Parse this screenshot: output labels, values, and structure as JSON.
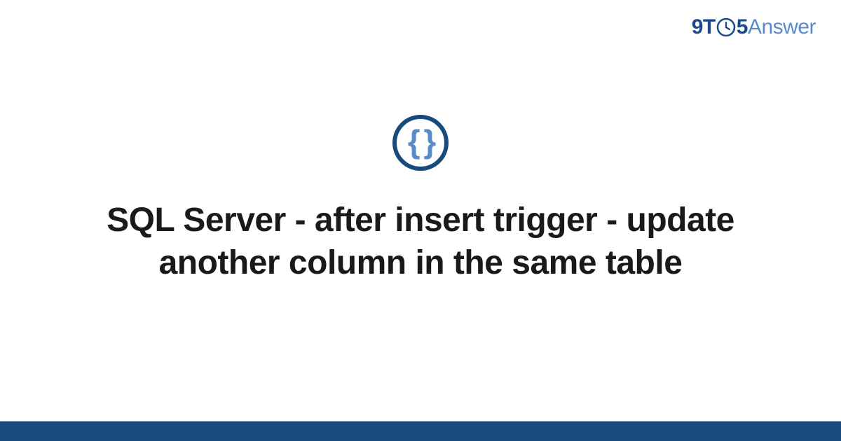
{
  "logo": {
    "part_9t": "9T",
    "part_5": "5",
    "part_answer": "Answer"
  },
  "category_icon": {
    "name": "code-braces-icon",
    "glyph": "{ }"
  },
  "title": "SQL Server - after insert trigger - update another column in the same table",
  "colors": {
    "brand_dark": "#184a7c",
    "brand_light": "#5a8bc9"
  }
}
